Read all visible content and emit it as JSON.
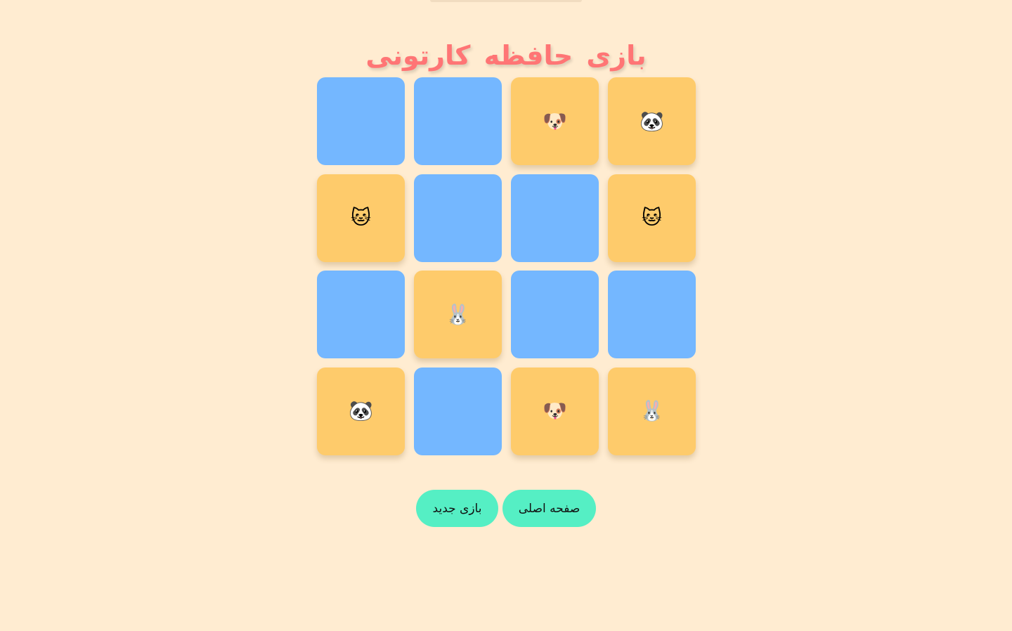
{
  "title": "بازی حافظه کارتونی",
  "board": {
    "columns": 4,
    "rows": 4,
    "cards": [
      {
        "state": "hidden",
        "face": ""
      },
      {
        "state": "hidden",
        "face": ""
      },
      {
        "state": "revealed",
        "face": "🐶",
        "icon": "dog-face-icon"
      },
      {
        "state": "revealed",
        "face": "🐼",
        "icon": "panda-face-icon"
      },
      {
        "state": "revealed",
        "face": "🐱",
        "icon": "cat-face-icon"
      },
      {
        "state": "hidden",
        "face": ""
      },
      {
        "state": "hidden",
        "face": ""
      },
      {
        "state": "revealed",
        "face": "🐱",
        "icon": "cat-face-icon"
      },
      {
        "state": "hidden",
        "face": ""
      },
      {
        "state": "revealed",
        "face": "🐰",
        "icon": "rabbit-face-icon"
      },
      {
        "state": "hidden",
        "face": ""
      },
      {
        "state": "hidden",
        "face": ""
      },
      {
        "state": "revealed",
        "face": "🐼",
        "icon": "panda-face-icon"
      },
      {
        "state": "hidden",
        "face": ""
      },
      {
        "state": "revealed",
        "face": "🐶",
        "icon": "dog-face-icon"
      },
      {
        "state": "revealed",
        "face": "🐰",
        "icon": "rabbit-face-icon"
      }
    ]
  },
  "buttons": {
    "home_label": "صفحه اصلی",
    "new_game_label": "بازی جدید"
  },
  "colors": {
    "background": "#ffecd1",
    "title": "#ff7575",
    "card_hidden": "#74b7ff",
    "card_revealed": "#fecb6b",
    "button": "#55efc4"
  }
}
